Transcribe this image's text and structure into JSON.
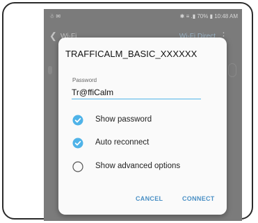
{
  "statusbar": {
    "left_icons": "☃ ✉",
    "right": "✱ ≡ .▮ 70% ▮ 10:48 AM"
  },
  "appbar": {
    "back_glyph": "❮",
    "title": "Wi-Fi",
    "action": "Wi-Fi Direct",
    "more_glyph": "⋮"
  },
  "dialog": {
    "ssid": "TRAFFICALM_BASIC_XXXXXX",
    "password_label": "Password",
    "password_value": "Tr@ffiCalm",
    "options": [
      {
        "label": "Show password",
        "checked": true
      },
      {
        "label": "Auto reconnect",
        "checked": true
      },
      {
        "label": "Show advanced options",
        "checked": false
      }
    ],
    "cancel_label": "CANCEL",
    "connect_label": "CONNECT"
  },
  "colors": {
    "accent": "#4fb3e8",
    "button_text": "#4a90c5",
    "dim_background": "#7b7b7b"
  }
}
